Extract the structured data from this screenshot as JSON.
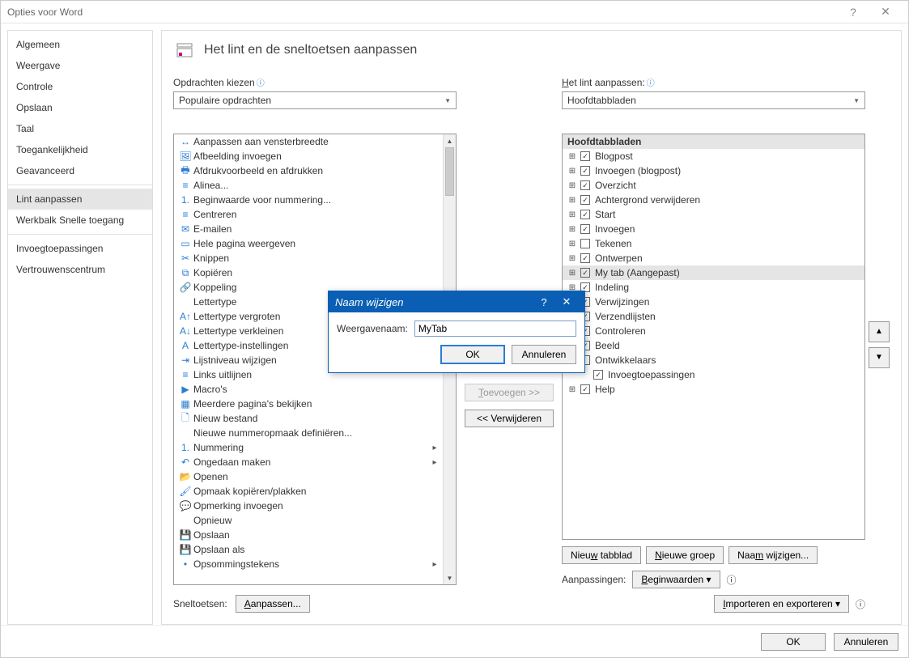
{
  "title": "Opties voor Word",
  "sidebar": {
    "items": [
      "Algemeen",
      "Weergave",
      "Controle",
      "Opslaan",
      "Taal",
      "Toegankelijkheid",
      "Geavanceerd",
      "Lint aanpassen",
      "Werkbalk Snelle toegang",
      "Invoegtoepassingen",
      "Vertrouwenscentrum"
    ],
    "selected_index": 7,
    "separators_after": [
      6,
      8
    ]
  },
  "header": {
    "title": "Het lint en de sneltoetsen aanpassen"
  },
  "left": {
    "label": "Opdrachten kiezen",
    "dropdown": "Populaire opdrachten",
    "commands": [
      {
        "label": "Aanpassen aan vensterbreedte",
        "icon": "fit"
      },
      {
        "label": "Afbeelding invoegen",
        "icon": "image"
      },
      {
        "label": "Afdrukvoorbeeld en afdrukken",
        "icon": "print"
      },
      {
        "label": "Alinea...",
        "icon": "paragraph"
      },
      {
        "label": "Beginwaarde voor nummering...",
        "icon": "num"
      },
      {
        "label": "Centreren",
        "icon": "center"
      },
      {
        "label": "E-mailen",
        "icon": "mail"
      },
      {
        "label": "Hele pagina weergeven",
        "icon": "page"
      },
      {
        "label": "Knippen",
        "icon": "cut"
      },
      {
        "label": "Kopiëren",
        "icon": "copy"
      },
      {
        "label": "Koppeling",
        "icon": "link"
      },
      {
        "label": "Lettertype",
        "icon": ""
      },
      {
        "label": "Lettertype vergroten",
        "icon": "fontup"
      },
      {
        "label": "Lettertype verkleinen",
        "icon": "fontdown"
      },
      {
        "label": "Lettertype-instellingen",
        "icon": "font"
      },
      {
        "label": "Lijstniveau wijzigen",
        "icon": "indent",
        "sub": true
      },
      {
        "label": "Links uitlijnen",
        "icon": "left"
      },
      {
        "label": "Macro's",
        "icon": "macro"
      },
      {
        "label": "Meerdere pagina's bekijken",
        "icon": "pages"
      },
      {
        "label": "Nieuw bestand",
        "icon": "new"
      },
      {
        "label": "Nieuwe nummeropmaak definiëren...",
        "icon": ""
      },
      {
        "label": "Nummering",
        "icon": "numbering",
        "sub": true
      },
      {
        "label": "Ongedaan maken",
        "icon": "undo",
        "sub": true
      },
      {
        "label": "Openen",
        "icon": "open"
      },
      {
        "label": "Opmaak kopiëren/plakken",
        "icon": "format"
      },
      {
        "label": "Opmerking invoegen",
        "icon": "comment"
      },
      {
        "label": "Opnieuw",
        "icon": ""
      },
      {
        "label": "Opslaan",
        "icon": "save"
      },
      {
        "label": "Opslaan als",
        "icon": "saveas"
      },
      {
        "label": "Opsommingstekens",
        "icon": "bullets",
        "sub": true
      }
    ]
  },
  "middle": {
    "add": "Toevoegen >>",
    "remove": "<< Verwijderen"
  },
  "right": {
    "label": "Het lint aanpassen:",
    "dropdown": "Hoofdtabbladen",
    "tree_header": "Hoofdtabbladen",
    "tabs": [
      {
        "label": "Blogpost",
        "checked": true,
        "exp": true
      },
      {
        "label": "Invoegen (blogpost)",
        "checked": true,
        "exp": true
      },
      {
        "label": "Overzicht",
        "checked": true,
        "exp": true
      },
      {
        "label": "Achtergrond verwijderen",
        "checked": true,
        "exp": true
      },
      {
        "label": "Start",
        "checked": true,
        "exp": true
      },
      {
        "label": "Invoegen",
        "checked": true,
        "exp": true
      },
      {
        "label": "Tekenen",
        "checked": false,
        "exp": true
      },
      {
        "label": "Ontwerpen",
        "checked": true,
        "exp": true
      },
      {
        "label": "My tab (Aangepast)",
        "checked": true,
        "exp": true,
        "selected": true
      },
      {
        "label": "Indeling",
        "checked": true,
        "exp": true
      },
      {
        "label": "Verwijzingen",
        "checked": true,
        "exp": true
      },
      {
        "label": "Verzendlijsten",
        "checked": true,
        "exp": true
      },
      {
        "label": "Controleren",
        "checked": true,
        "exp": true
      },
      {
        "label": "Beeld",
        "checked": true,
        "exp": true
      },
      {
        "label": "Ontwikkelaars",
        "checked": false,
        "exp": true
      },
      {
        "label": "Invoegtoepassingen",
        "checked": true,
        "exp": false,
        "indent": true
      },
      {
        "label": "Help",
        "checked": true,
        "exp": true
      }
    ],
    "new_tab": "Nieuw tabblad",
    "new_group": "Nieuwe groep",
    "rename": "Naam wijzigen...",
    "customizations": "Aanpassingen:",
    "reset": "Beginwaarden",
    "import_export": "Importeren en exporteren"
  },
  "shortcut": {
    "label": "Sneltoetsen:",
    "button": "Aanpassen..."
  },
  "footer": {
    "ok": "OK",
    "cancel": "Annuleren"
  },
  "modal": {
    "title": "Naam wijzigen",
    "field_label": "Weergavenaam:",
    "value": "MyTab",
    "ok": "OK",
    "cancel": "Annuleren"
  }
}
